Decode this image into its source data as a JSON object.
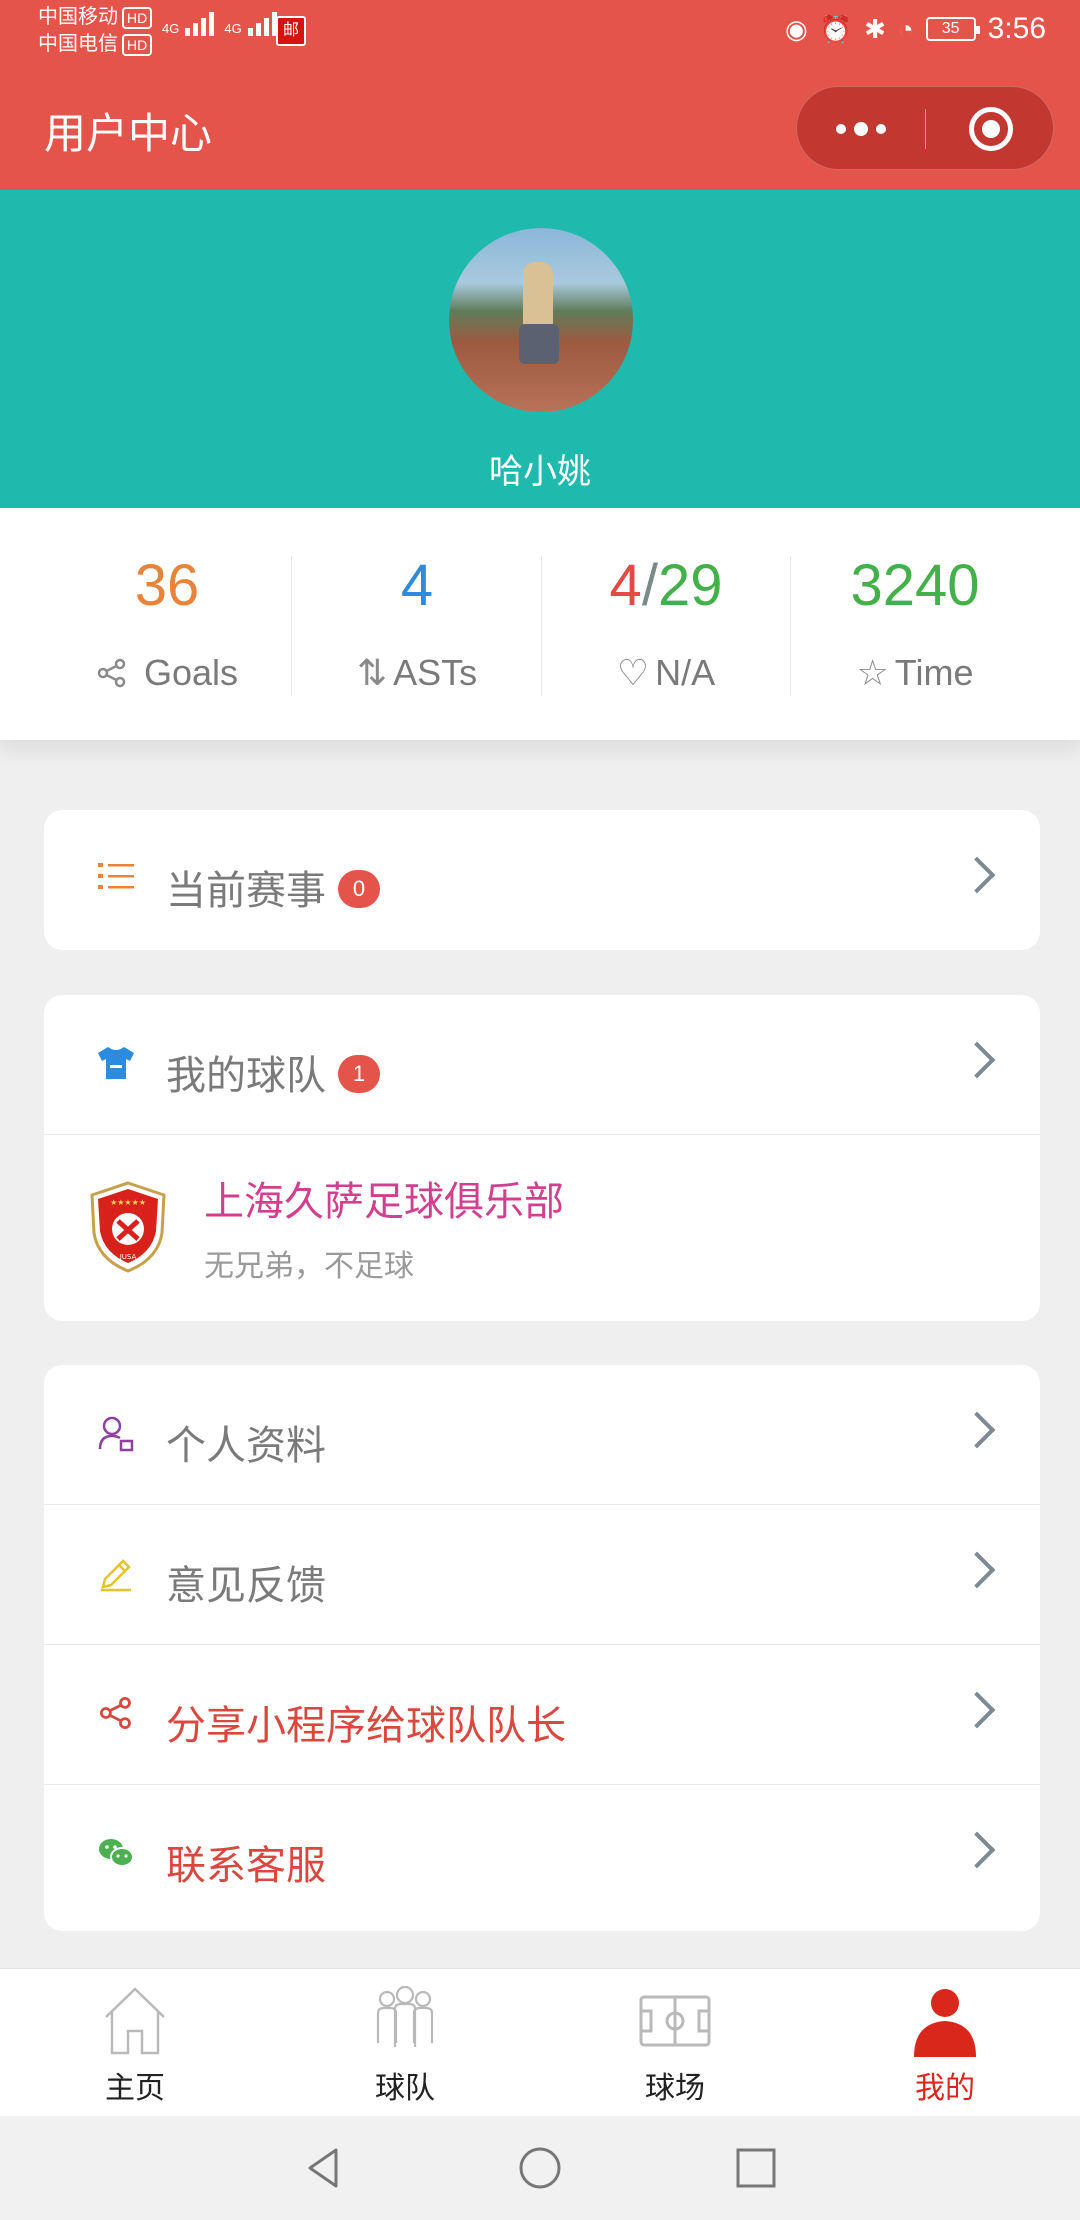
{
  "status_bar": {
    "carrier1": "中国移动",
    "carrier2": "中国电信",
    "hd": "HD",
    "network": "4G",
    "battery": "35",
    "time": "3:56"
  },
  "header": {
    "title": "用户中心"
  },
  "profile": {
    "username": "哈小姚"
  },
  "stats": [
    {
      "value": "36",
      "label": "Goals",
      "icon": "share-icon",
      "color": "#e8843a"
    },
    {
      "value": "4",
      "label": "ASTs",
      "icon": "sort-arrows-icon",
      "color": "#2a8be0"
    },
    {
      "value_a": "4",
      "value_sep": "/",
      "value_b": "29",
      "label": "N/A",
      "icon": "heart-icon",
      "color_a": "#e24a43",
      "color_b": "#43b04a"
    },
    {
      "value": "3240",
      "label": "Time",
      "icon": "star-icon",
      "color": "#43b04a"
    }
  ],
  "current_match": {
    "label": "当前赛事",
    "badge": "0"
  },
  "my_team": {
    "label": "我的球队",
    "badge": "1",
    "team_name": "上海久萨足球俱乐部",
    "team_slogan": "无兄弟，不足球",
    "logo_text": "JUSA"
  },
  "menu": [
    {
      "label": "个人资料",
      "icon": "profile-icon"
    },
    {
      "label": "意见反馈",
      "icon": "pencil-icon"
    },
    {
      "label": "分享小程序给球队队长",
      "icon": "share-icon"
    },
    {
      "label": "联系客服",
      "icon": "wechat-icon"
    }
  ],
  "tabbar": [
    {
      "label": "主页",
      "icon": "home-icon"
    },
    {
      "label": "球队",
      "icon": "team-icon"
    },
    {
      "label": "球场",
      "icon": "field-icon"
    },
    {
      "label": "我的",
      "icon": "user-icon",
      "active": true
    }
  ],
  "colors": {
    "header": "#e5544b",
    "profile_bg": "#1fb9ad",
    "active_tab": "#d9271c"
  }
}
